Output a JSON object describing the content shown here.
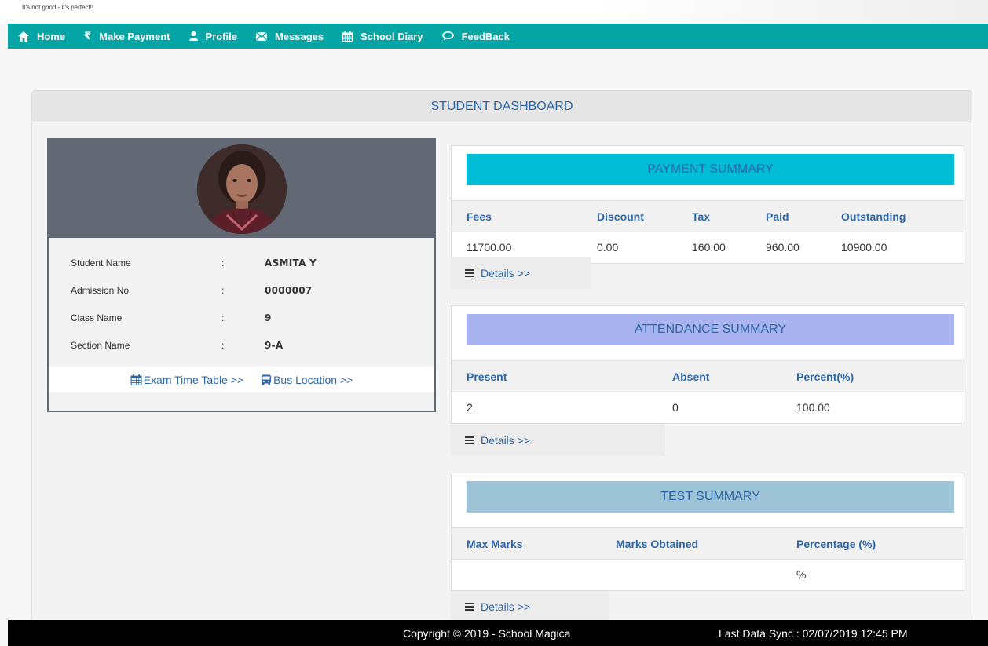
{
  "tagline": "It's not good - it's perfect!!",
  "nav": [
    {
      "label": "Home",
      "icon": "home-icon"
    },
    {
      "label": "Make Payment",
      "icon": "rupee-icon"
    },
    {
      "label": "Profile",
      "icon": "user-icon"
    },
    {
      "label": "Messages",
      "icon": "envelope-icon"
    },
    {
      "label": "School Diary",
      "icon": "calendar-icon"
    },
    {
      "label": "FeedBack",
      "icon": "comment-icon"
    }
  ],
  "dashboard": {
    "title": "STUDENT DASHBOARD"
  },
  "student": {
    "rows": [
      {
        "label": "Student Name",
        "sep": ":",
        "value": "ASMITA Y"
      },
      {
        "label": "Admission No",
        "sep": ":",
        "value": "0000007"
      },
      {
        "label": "Class Name",
        "sep": ":",
        "value": "9"
      },
      {
        "label": "Section Name",
        "sep": ":",
        "value": "9-A"
      }
    ],
    "exam_link": "Exam Time Table >>",
    "bus_link": "Bus Location >>"
  },
  "payment": {
    "title": "PAYMENT SUMMARY",
    "headers": [
      "Fees",
      "Discount",
      "Tax",
      "Paid",
      "Outstanding"
    ],
    "row": [
      "11700.00",
      "0.00",
      "160.00",
      "960.00",
      "10900.00"
    ],
    "details": "Details >>"
  },
  "attendance": {
    "title": "ATTENDANCE SUMMARY",
    "headers": [
      "Present",
      "Absent",
      "Percent(%)"
    ],
    "row": [
      "2",
      "0",
      "100.00"
    ],
    "details": "Details >>"
  },
  "test": {
    "title": "TEST SUMMARY",
    "headers": [
      "Max Marks",
      "Marks Obtained",
      "Percentage (%)"
    ],
    "row": [
      "",
      "",
      "%"
    ],
    "details": "Details >>"
  },
  "footer": {
    "copyright": "Copyright © 2019 - School Magica",
    "sync": "Last Data Sync : 02/07/2019 12:45 PM"
  },
  "colors": {
    "navbar": "#05a5a6",
    "payment_title": "#00bcd4",
    "attendance_title": "#a9b3ef",
    "test_title": "#9ec5d7",
    "link": "#2c66a9"
  }
}
